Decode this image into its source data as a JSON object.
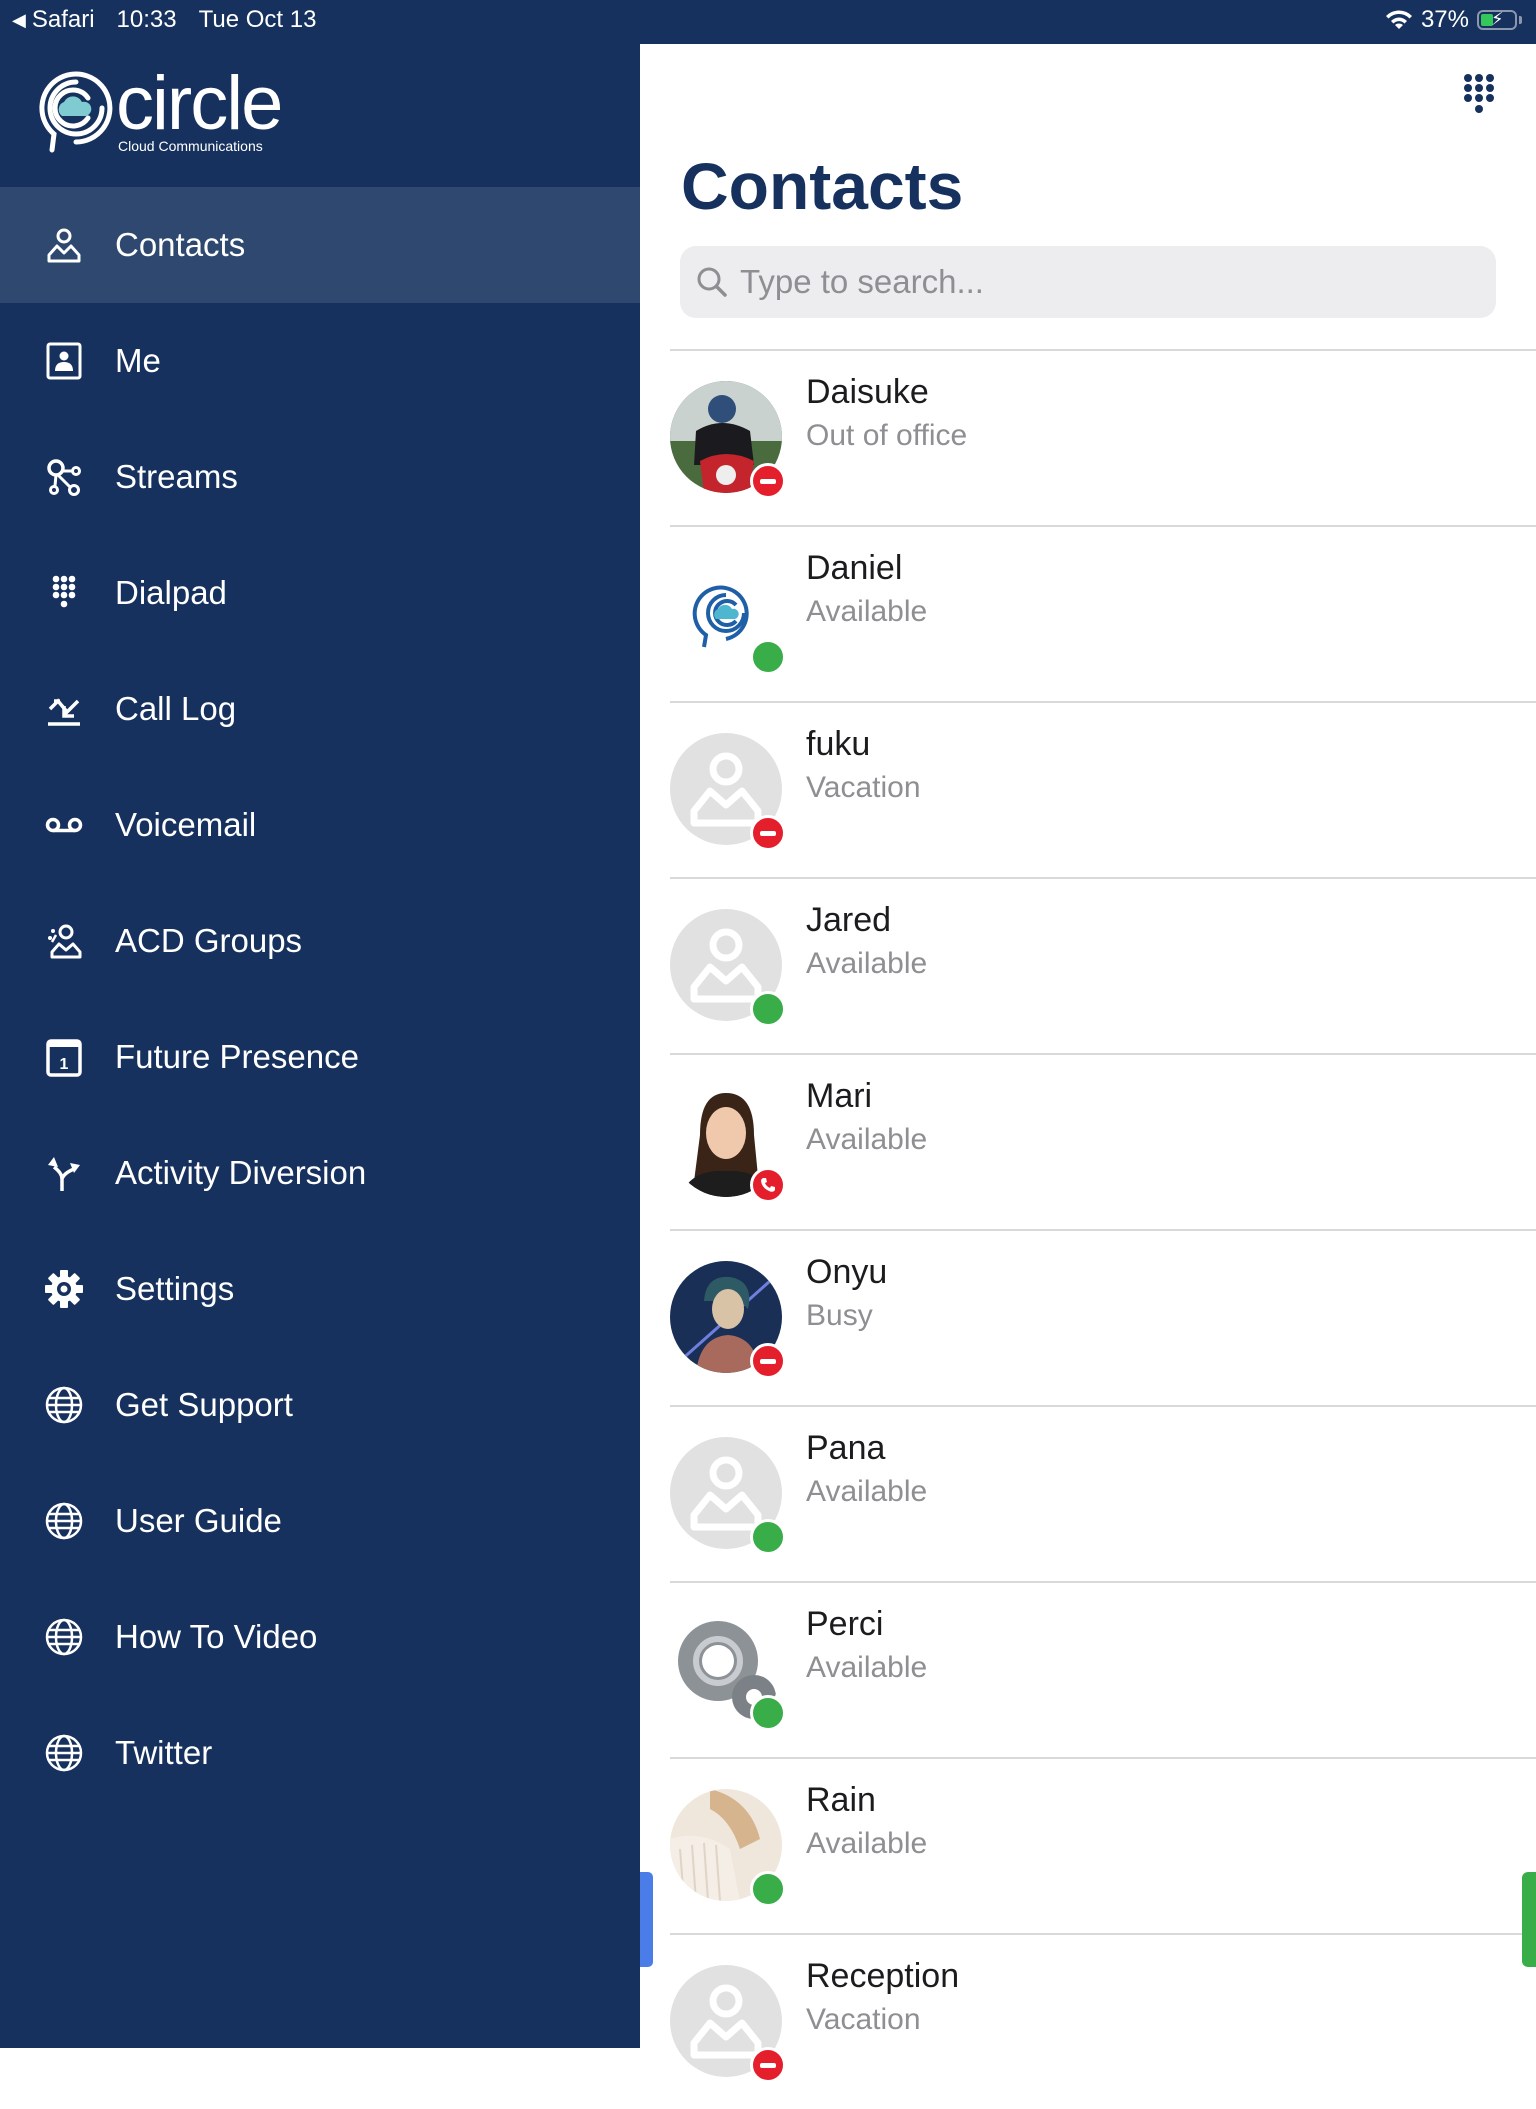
{
  "status_bar": {
    "back_app": "Safari",
    "time": "10:33",
    "date": "Tue Oct 13",
    "battery_percent": "37%",
    "battery_level": 0.37,
    "charging": true
  },
  "sidebar": {
    "logo": {
      "wordmark": "circle",
      "tagline": "Cloud Communications"
    },
    "active_item": "Contacts",
    "items": [
      {
        "label": "Contacts",
        "icon": "person-icon"
      },
      {
        "label": "Me",
        "icon": "contact-card-icon"
      },
      {
        "label": "Streams",
        "icon": "streams-icon"
      },
      {
        "label": "Dialpad",
        "icon": "dialpad-icon"
      },
      {
        "label": "Call Log",
        "icon": "call-log-icon"
      },
      {
        "label": "Voicemail",
        "icon": "voicemail-icon"
      },
      {
        "label": "ACD Groups",
        "icon": "group-icon"
      },
      {
        "label": "Future Presence",
        "icon": "calendar-icon"
      },
      {
        "label": "Activity Diversion",
        "icon": "diversion-icon"
      },
      {
        "label": "Settings",
        "icon": "gear-icon"
      },
      {
        "label": "Get Support",
        "icon": "globe-icon"
      },
      {
        "label": "User Guide",
        "icon": "globe-icon"
      },
      {
        "label": "How To Video",
        "icon": "globe-icon"
      },
      {
        "label": "Twitter",
        "icon": "globe-icon"
      }
    ]
  },
  "main": {
    "title": "Contacts",
    "search": {
      "placeholder": "Type to search...",
      "value": ""
    },
    "contacts": [
      {
        "name": "Daisuke",
        "status": "Out of office",
        "presence": "dnd",
        "avatar": "photo-motorcycle"
      },
      {
        "name": "Daniel",
        "status": "Available",
        "presence": "available",
        "avatar": "circle-logo"
      },
      {
        "name": "fuku",
        "status": "Vacation",
        "presence": "dnd",
        "avatar": "placeholder"
      },
      {
        "name": "Jared",
        "status": "Available",
        "presence": "available",
        "avatar": "placeholder"
      },
      {
        "name": "Mari",
        "status": "Available",
        "presence": "on-call",
        "avatar": "photo-woman"
      },
      {
        "name": "Onyu",
        "status": "Busy",
        "presence": "dnd",
        "avatar": "photo-anime"
      },
      {
        "name": "Pana",
        "status": "Available",
        "presence": "available",
        "avatar": "placeholder"
      },
      {
        "name": "Perci",
        "status": "Available",
        "presence": "available",
        "avatar": "gears"
      },
      {
        "name": "Rain",
        "status": "Available",
        "presence": "available",
        "avatar": "photo-sweater"
      },
      {
        "name": "Reception",
        "status": "Vacation",
        "presence": "dnd",
        "avatar": "placeholder"
      }
    ]
  },
  "colors": {
    "brand_navy": "#16315d",
    "active_nav": "#2e4870",
    "available": "#38ad48",
    "dnd": "#e41e2b",
    "left_handle": "#4a7de8"
  }
}
